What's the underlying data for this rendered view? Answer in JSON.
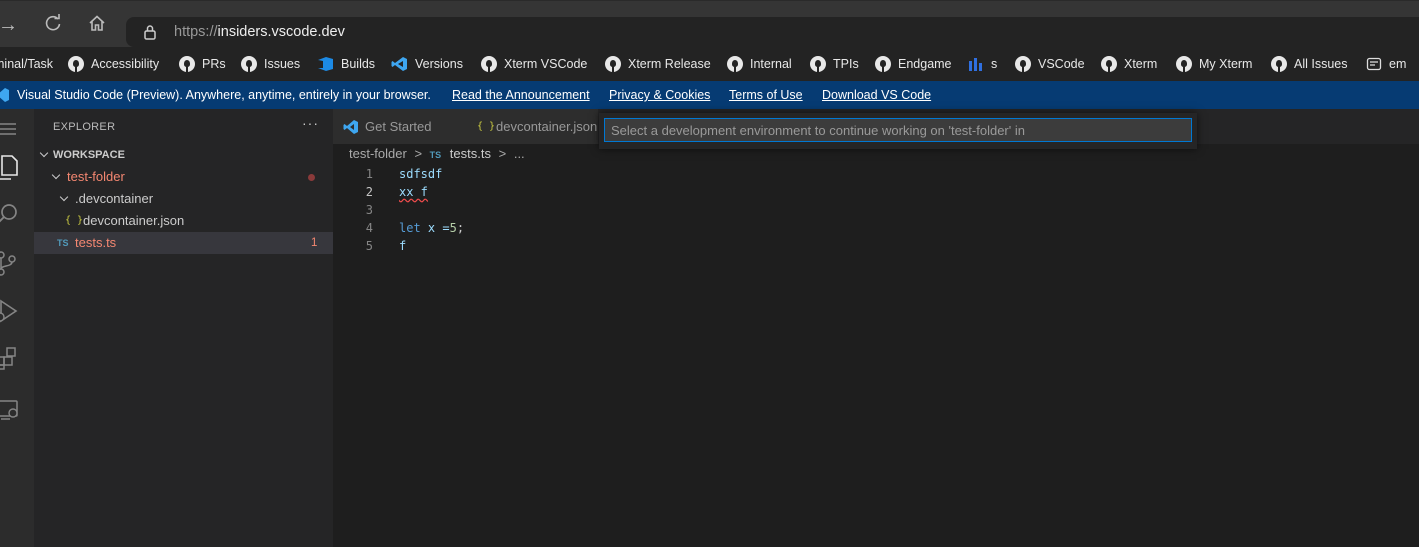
{
  "browser": {
    "url_scheme": "https://",
    "url_host": "insiders.vscode.dev"
  },
  "bookmarks": [
    {
      "label": "minal/Task",
      "icon": "none"
    },
    {
      "label": "Accessibility",
      "icon": "github-icon"
    },
    {
      "label": "PRs",
      "icon": "github-icon"
    },
    {
      "label": "Issues",
      "icon": "github-icon"
    },
    {
      "label": "Builds",
      "icon": "azure-devops-icon"
    },
    {
      "label": "Versions",
      "icon": "vscode-icon"
    },
    {
      "label": "Xterm VSCode",
      "icon": "github-icon"
    },
    {
      "label": "Xterm Release",
      "icon": "github-icon"
    },
    {
      "label": "Internal",
      "icon": "github-icon"
    },
    {
      "label": "TPIs",
      "icon": "github-icon"
    },
    {
      "label": "Endgame",
      "icon": "github-icon"
    },
    {
      "label": "s",
      "icon": "chart-icon"
    },
    {
      "label": "VSCode",
      "icon": "github-icon"
    },
    {
      "label": "Xterm",
      "icon": "github-icon"
    },
    {
      "label": "My Xterm",
      "icon": "github-icon"
    },
    {
      "label": "All Issues",
      "icon": "github-icon"
    },
    {
      "label": "em",
      "icon": "note-icon"
    }
  ],
  "banner": {
    "text": "Visual Studio Code (Preview). Anywhere, anytime, entirely in your browser.",
    "links": [
      "Read the Announcement",
      "Privacy & Cookies",
      "Terms of Use",
      "Download VS Code"
    ]
  },
  "sidebar": {
    "title": "EXPLORER",
    "more": "···",
    "workspace": "WORKSPACE",
    "folder": "test-folder",
    "subfolder": ".devcontainer",
    "json_icon": "{ }",
    "json_file": "devcontainer.json",
    "ts_icon": "TS",
    "ts_file": "tests.ts",
    "ts_errors": "1"
  },
  "tabs": [
    {
      "label": "Get Started",
      "icon": "vscode-icon"
    },
    {
      "label": "devcontainer.json",
      "icon": "json-icon"
    }
  ],
  "breadcrumb": {
    "folder": "test-folder",
    "sep": ">",
    "icon": "TS",
    "file": "tests.ts",
    "more": "..."
  },
  "editor": {
    "lines": [
      {
        "n": "1",
        "text": "sdfsdf"
      },
      {
        "n": "2",
        "text": "xx f"
      },
      {
        "n": "3",
        "text": ""
      },
      {
        "n": "4",
        "kw": "let",
        "rest_a": " x =",
        "num": "5",
        "rest_b": ";"
      },
      {
        "n": "5",
        "text": "f"
      }
    ]
  },
  "quickpick": {
    "placeholder": "Select a development environment to continue working on 'test-folder' in"
  },
  "colors": {
    "banner_bg": "#063b73",
    "accent": "#0078d4",
    "error": "#f48771"
  }
}
